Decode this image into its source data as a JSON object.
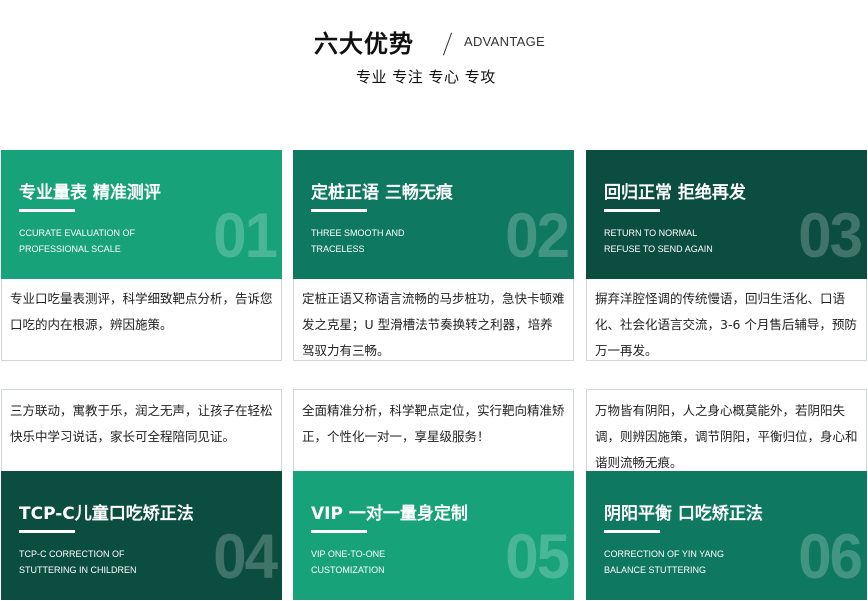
{
  "header": {
    "title": "六大优势",
    "title_en": "ADVANTAGE",
    "subtitle": "专业 专注 专心 专攻"
  },
  "cards": [
    {
      "title": "专业量表 精准测评",
      "en_line1": "CCURATE EVALUATION OF",
      "en_line2": "PROFESSIONAL SCALE",
      "number": "01",
      "description": "专业口吃量表测评，科学细致靶点分析，告诉您口吃的内在根源，辨因施策。",
      "panel_color": "#17a27a"
    },
    {
      "title": "定桩正语 三畅无痕",
      "en_line1": "THREE SMOOTH AND",
      "en_line2": "TRACELESS",
      "number": "02",
      "description": "定桩正语又称语言流畅的马步桩功，急快卡顿难发之克星；U 型滑槽法节奏换转之利器，培养驾驭力有三畅。",
      "panel_color": "#0f7860"
    },
    {
      "title": "回归正常 拒绝再发",
      "en_line1": "RETURN TO NORMAL",
      "en_line2": "REFUSE TO SEND AGAIN",
      "number": "03",
      "description": "摒弃洋腔怪调的传统慢语，回归生活化、口语化、社会化语言交流，3-6 个月售后辅导，预防万一再发。",
      "panel_color": "#0b4d3e"
    },
    {
      "title": "TCP-C儿童口吃矫正法",
      "en_line1": "TCP-C CORRECTION OF",
      "en_line2": "STUTTERING IN CHILDREN",
      "number": "04",
      "description": "三方联动，寓教于乐，润之无声，让孩子在轻松快乐中学习说话，家长可全程陪同见证。",
      "panel_color": "#0b4d3e"
    },
    {
      "title": "VIP 一对一量身定制",
      "en_line1": "VIP ONE-TO-ONE",
      "en_line2": "CUSTOMIZATION",
      "number": "05",
      "description": "全面精准分析，科学靶点定位，实行靶向精准矫正，个性化一对一，享星级服务！",
      "panel_color": "#17a27a"
    },
    {
      "title": "阴阳平衡 口吃矫正法",
      "en_line1": "CORRECTION OF YIN YANG",
      "en_line2": "BALANCE STUTTERING",
      "number": "06",
      "description": "万物皆有阴阳，人之身心概莫能外，若阴阳失调，则辨因施策，调节阴阳，平衡归位，身心和谐则流畅无痕。",
      "panel_color": "#0f7860"
    }
  ]
}
